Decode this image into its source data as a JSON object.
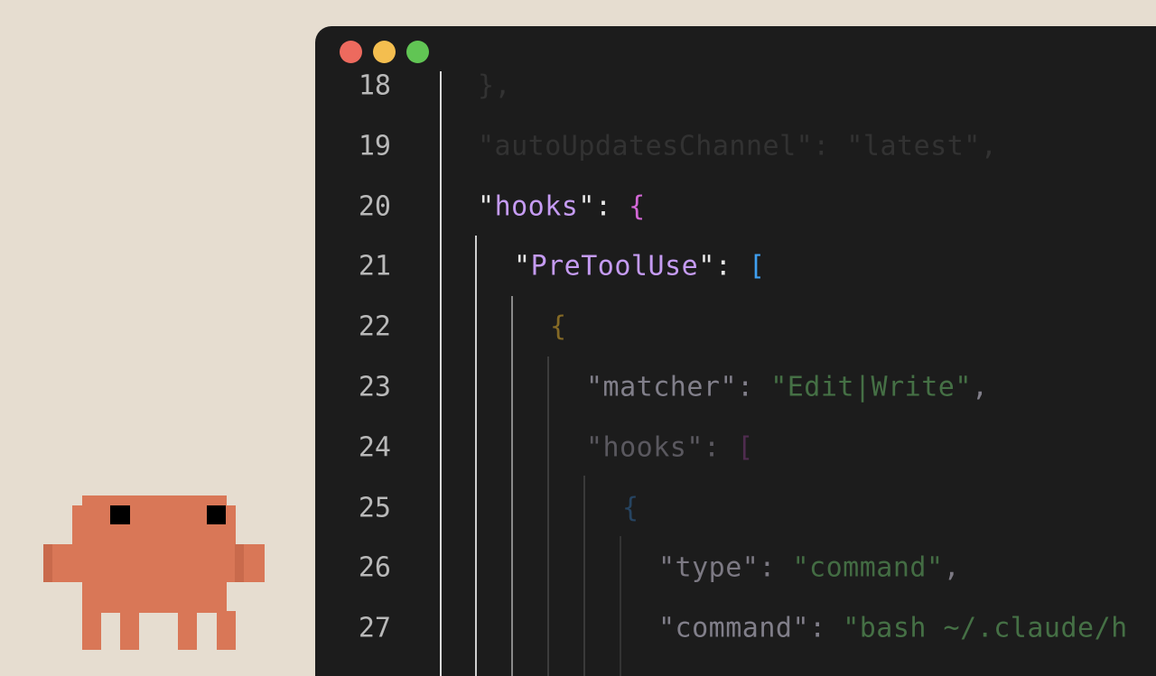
{
  "window": {
    "controls": [
      "close",
      "minimize",
      "zoom"
    ]
  },
  "editor": {
    "lines": [
      {
        "number": "18",
        "tokens": [
          {
            "text": "},",
            "color": "#cccccc"
          }
        ]
      },
      {
        "number": "19",
        "tokens": [
          {
            "text": "\"autoUpdatesChannel\"",
            "color": "#cccccc"
          },
          {
            "text": ": ",
            "color": "#cccccc"
          },
          {
            "text": "\"latest\"",
            "color": "#cccccc"
          },
          {
            "text": ",",
            "color": "#cccccc"
          }
        ]
      },
      {
        "number": "20",
        "tokens": [
          {
            "text": "\"",
            "color": "#e8e8e8"
          },
          {
            "text": "hooks",
            "color": "#c59bf2"
          },
          {
            "text": "\"",
            "color": "#e8e8e8"
          },
          {
            "text": ": ",
            "color": "#e8e8e8"
          },
          {
            "text": "{",
            "color": "#d267d5"
          }
        ]
      },
      {
        "number": "21",
        "tokens": [
          {
            "text": "\"",
            "color": "#e8e8e8"
          },
          {
            "text": "PreToolUse",
            "color": "#c59bf2"
          },
          {
            "text": "\"",
            "color": "#e8e8e8"
          },
          {
            "text": ": ",
            "color": "#e8e8e8"
          },
          {
            "text": "[",
            "color": "#3f9ff0"
          }
        ]
      },
      {
        "number": "22",
        "tokens": [
          {
            "text": "{",
            "color": "#b08a2a"
          }
        ]
      },
      {
        "number": "23",
        "tokens": [
          {
            "text": "\"matcher\"",
            "color": "#8d8a96"
          },
          {
            "text": ": ",
            "color": "#8d8a96"
          },
          {
            "text": "\"Edit|Write\"",
            "color": "#4a7a4a"
          },
          {
            "text": ",",
            "color": "#8d8a96"
          }
        ]
      },
      {
        "number": "24",
        "tokens": [
          {
            "text": "\"hooks\"",
            "color": "#8d8a96"
          },
          {
            "text": ": ",
            "color": "#8d8a96"
          },
          {
            "text": "[",
            "color": "#7a3a7a"
          }
        ]
      },
      {
        "number": "25",
        "tokens": [
          {
            "text": "{",
            "color": "#2e5f8f"
          }
        ]
      },
      {
        "number": "26",
        "tokens": [
          {
            "text": "\"type\"",
            "color": "#8d8a96"
          },
          {
            "text": ": ",
            "color": "#8d8a96"
          },
          {
            "text": "\"command\"",
            "color": "#4a7a4a"
          },
          {
            "text": ",",
            "color": "#8d8a96"
          }
        ]
      },
      {
        "number": "27",
        "tokens": [
          {
            "text": "\"command\"",
            "color": "#8d8a96"
          },
          {
            "text": ": ",
            "color": "#8d8a96"
          },
          {
            "text": "\"bash ~/.claude/h",
            "color": "#4a7a4a"
          }
        ]
      }
    ]
  },
  "colors": {
    "background": "#e6ddd0",
    "editor_bg": "#1c1c1c",
    "mascot": "#d97756"
  }
}
